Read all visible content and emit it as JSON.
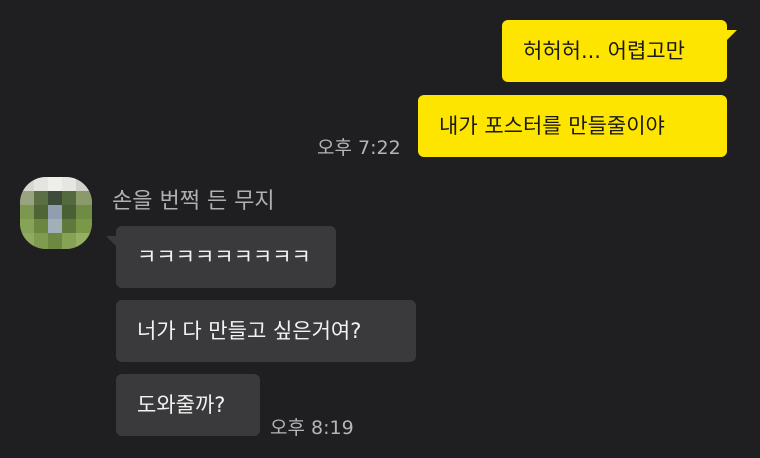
{
  "chat": {
    "sent": [
      {
        "text": "허허허... 어렵고만"
      },
      {
        "text": "내가 포스터를 만들줄이야",
        "time": "오후 7:22"
      }
    ],
    "sender_name": "손을 번쩍 든 무지",
    "received": [
      {
        "text": "ㅋㅋㅋㅋㅋㅋㅋㅋㅋ"
      },
      {
        "text": "너가 다 만들고 싶은거여?"
      },
      {
        "text": "도와줄까?",
        "time": "오후 8:19"
      }
    ]
  },
  "colors": {
    "background": "#1f1f21",
    "sent_bubble": "#fee500",
    "received_bubble": "#3a3a3c"
  }
}
